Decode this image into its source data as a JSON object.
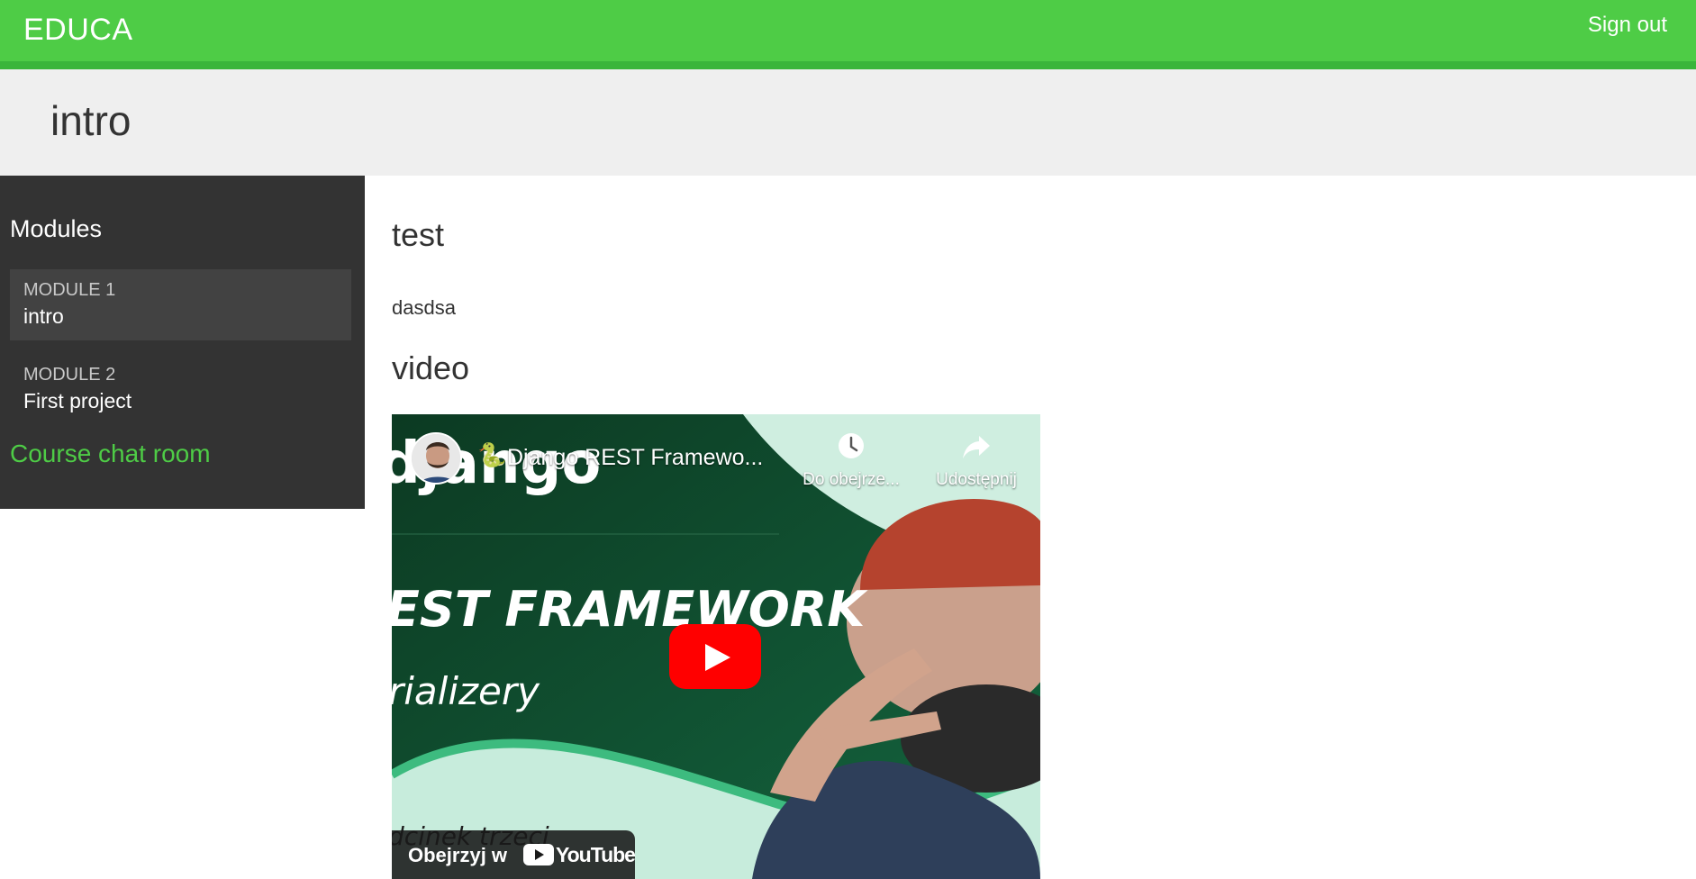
{
  "app": {
    "brand": "EDUCA",
    "signout_label": "Sign out"
  },
  "page": {
    "title": "intro"
  },
  "sidebar": {
    "heading": "Modules",
    "modules": [
      {
        "number": "MODULE 1",
        "title": "intro",
        "active": true
      },
      {
        "number": "MODULE 2",
        "title": "First project",
        "active": false
      }
    ],
    "chat_link": "Course chat room"
  },
  "content": {
    "items": [
      {
        "title": "test",
        "text": "dasdsa"
      },
      {
        "title": "video"
      }
    ]
  },
  "video": {
    "title": "Django REST Framewo...",
    "watch_later_label": "Do obejrze...",
    "share_label": "Udostępnij",
    "watch_on_label": "Obejrzyj w",
    "youtube_wordmark": "YouTube",
    "thumbnail_text": {
      "logo": "django",
      "headline": "EST FRAMEWORK",
      "subtitle": "rializery",
      "episode": "dcinek trzeci"
    }
  },
  "colors": {
    "accent": "#4ecc46",
    "sidebar_bg": "#333333",
    "youtube_red": "#ff0000"
  }
}
